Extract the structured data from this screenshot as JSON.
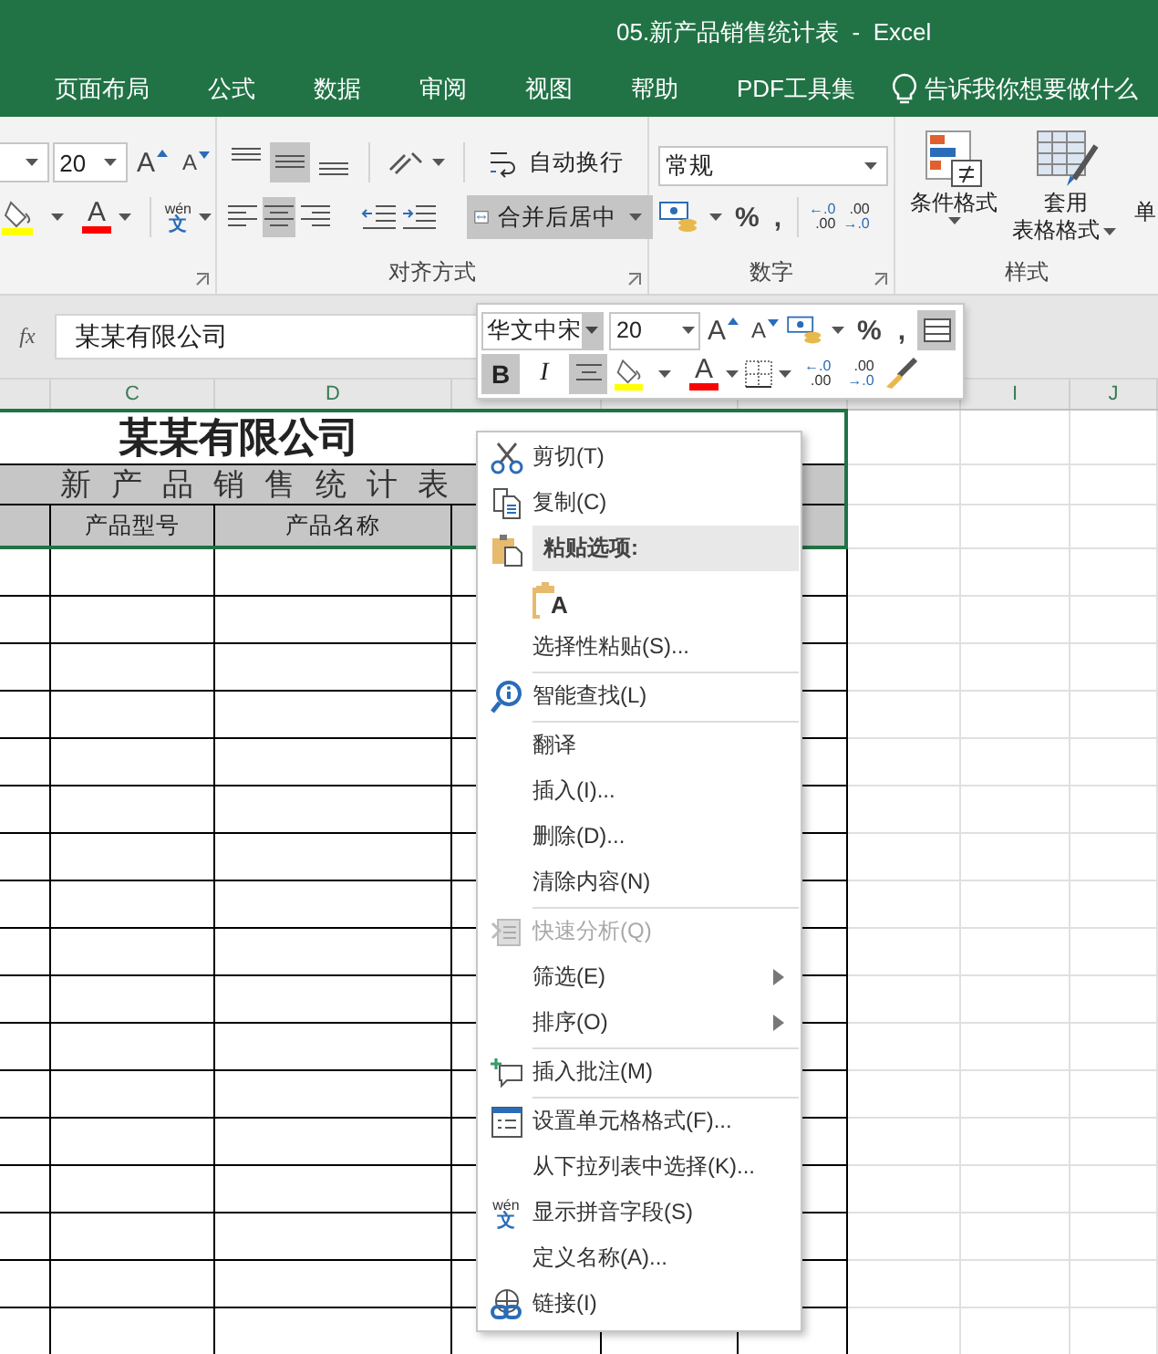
{
  "window": {
    "title": "05.新产品销售统计表  -  Excel"
  },
  "ribbon_tabs": [
    "页面布局",
    "公式",
    "数据",
    "审阅",
    "视图",
    "帮助",
    "PDF工具集"
  ],
  "tell_me": "告诉我你想要做什么",
  "ribbon": {
    "font": {
      "size": "20",
      "grow": "A",
      "shrink": "A",
      "font_color": "A",
      "phonetic": [
        "wén",
        "文"
      ]
    },
    "alignment": {
      "label": "对齐方式",
      "vertical": [
        {
          "selected": false
        },
        {
          "selected": true
        },
        {
          "selected": false
        }
      ],
      "horizontal": [
        {
          "selected": false
        },
        {
          "selected": true
        },
        {
          "selected": false
        }
      ],
      "wrap_text": "自动换行",
      "merge": {
        "label": "合并后居中",
        "selected": true
      }
    },
    "number": {
      "label": "数字",
      "format": "常规",
      "percent": "%",
      "comma": ",",
      "increase_decimal": [
        "←.0",
        ".00"
      ],
      "decrease_decimal": [
        ".00",
        "→.0"
      ]
    },
    "styles": {
      "label": "样式",
      "conditional": "条件格式",
      "table_format": [
        "套用",
        "表格格式"
      ],
      "cell_styles": "单"
    }
  },
  "formula_bar": {
    "function_label": "fx",
    "value": "某某有限公司"
  },
  "sheet": {
    "column_headers": [
      "C",
      "D",
      "I",
      "J"
    ],
    "title": "某某有限公司",
    "subtitle": "新产品销售统计表",
    "headers": [
      "产品型号",
      "产品名称"
    ]
  },
  "mini_toolbar": {
    "font": "华文中宋",
    "font_dropdown_selected": true,
    "size": "20",
    "grow": "A",
    "shrink": "A",
    "percent": "%",
    "comma": ",",
    "border_style_selected": true,
    "bold": {
      "label": "B",
      "selected": true
    },
    "italic": {
      "label": "I",
      "selected": false
    },
    "center_selected": true,
    "font_color": "A",
    "increase_decimal": [
      "←.0",
      ".00"
    ],
    "decrease_decimal": [
      ".00",
      "→.0"
    ]
  },
  "context_menu": [
    {
      "kind": "item",
      "label": "剪切(T)",
      "disabled": false,
      "has_submenu": false
    },
    {
      "kind": "item",
      "label": "复制(C)",
      "disabled": false,
      "has_submenu": false
    },
    {
      "kind": "heading",
      "label": "粘贴选项:"
    },
    {
      "kind": "paste_option",
      "glyph": "A"
    },
    {
      "kind": "item",
      "label": "选择性粘贴(S)...",
      "disabled": false,
      "has_submenu": false
    },
    {
      "kind": "separator"
    },
    {
      "kind": "item",
      "label": "智能查找(L)",
      "disabled": false,
      "has_submenu": false
    },
    {
      "kind": "separator"
    },
    {
      "kind": "item",
      "label": "翻译",
      "disabled": false,
      "has_submenu": false
    },
    {
      "kind": "item",
      "label": "插入(I)...",
      "disabled": false,
      "has_submenu": false
    },
    {
      "kind": "item",
      "label": "删除(D)...",
      "disabled": false,
      "has_submenu": false
    },
    {
      "kind": "item",
      "label": "清除内容(N)",
      "disabled": false,
      "has_submenu": false
    },
    {
      "kind": "separator"
    },
    {
      "kind": "item",
      "label": "快速分析(Q)",
      "disabled": true,
      "has_submenu": false
    },
    {
      "kind": "item",
      "label": "筛选(E)",
      "disabled": false,
      "has_submenu": true
    },
    {
      "kind": "item",
      "label": "排序(O)",
      "disabled": false,
      "has_submenu": true
    },
    {
      "kind": "separator"
    },
    {
      "kind": "item",
      "label": "插入批注(M)",
      "disabled": false,
      "has_submenu": false
    },
    {
      "kind": "separator"
    },
    {
      "kind": "item",
      "label": "设置单元格格式(F)...",
      "disabled": false,
      "has_submenu": false
    },
    {
      "kind": "item",
      "label": "从下拉列表中选择(K)...",
      "disabled": false,
      "has_submenu": false
    },
    {
      "kind": "item",
      "label": "显示拼音字段(S)",
      "disabled": false,
      "has_submenu": false,
      "glyph": [
        "wén",
        "文"
      ]
    },
    {
      "kind": "item",
      "label": "定义名称(A)...",
      "disabled": false,
      "has_submenu": false
    },
    {
      "kind": "item",
      "label": "链接(I)",
      "disabled": false,
      "has_submenu": false
    }
  ]
}
